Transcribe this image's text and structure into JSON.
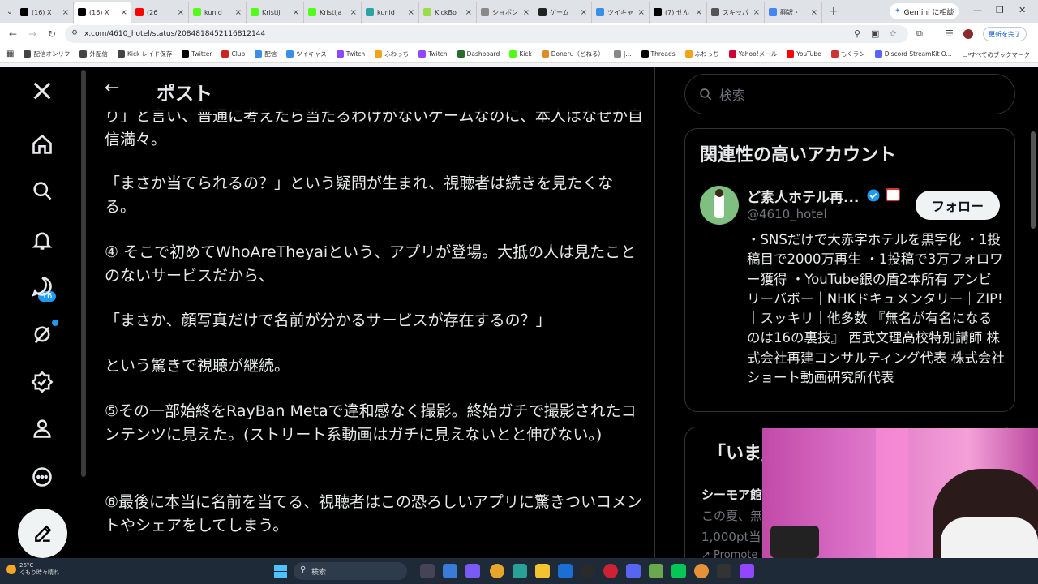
{
  "browser": {
    "tabs": [
      {
        "label": "(16) X",
        "icon": "x-icon",
        "color": "#000000"
      },
      {
        "label": "(16) X",
        "icon": "x-icon",
        "color": "#000000",
        "active": true
      },
      {
        "label": "(26",
        "icon": "youtube-icon",
        "color": "#ff0000"
      },
      {
        "label": "kunid",
        "icon": "kick-icon",
        "color": "#53fc18"
      },
      {
        "label": "Kristij",
        "icon": "kick-icon",
        "color": "#53fc18"
      },
      {
        "label": "Kristija",
        "icon": "kick-icon",
        "color": "#53fc18"
      },
      {
        "label": "kunid",
        "icon": "twitch-icon",
        "color": "#29a3a3"
      },
      {
        "label": "KickBo",
        "icon": "kickbot-icon",
        "color": "#9bdc4a"
      },
      {
        "label": "ショボン",
        "icon": "page-icon",
        "color": "#888888"
      },
      {
        "label": "ゲーム",
        "icon": "game-icon",
        "color": "#222222"
      },
      {
        "label": "ツイキャ",
        "icon": "twitcasting-icon",
        "color": "#3a8ee6"
      },
      {
        "label": "(7) せん",
        "icon": "x-icon",
        "color": "#000000"
      },
      {
        "label": "スキッパ",
        "icon": "page-icon",
        "color": "#555555"
      },
      {
        "label": "翻訳・",
        "icon": "google-icon",
        "color": "#4285f4"
      }
    ],
    "gemini_label": "Gemini に相談",
    "url": "x.com/4610_hotel/status/2084818452116812144",
    "update_label": "更新を完了",
    "bookmarks": [
      {
        "label": "配信オンリフ",
        "color": "#444444"
      },
      {
        "label": "外配信",
        "color": "#444444"
      },
      {
        "label": "Kick レイド保存",
        "color": "#444444"
      },
      {
        "label": "Twitter",
        "color": "#000000"
      },
      {
        "label": "Club",
        "color": "#cc2222"
      },
      {
        "label": "配信",
        "color": "#3a8ee6"
      },
      {
        "label": "ツイキャス",
        "color": "#3a8ee6"
      },
      {
        "label": "Twitch",
        "color": "#9146ff"
      },
      {
        "label": "ふわっち",
        "color": "#f2a31b"
      },
      {
        "label": "Twitch",
        "color": "#9146ff"
      },
      {
        "label": "Dashboard",
        "color": "#2a6a2a"
      },
      {
        "label": "Kick",
        "color": "#53fc18"
      },
      {
        "label": "Doneru（どねる）",
        "color": "#e08a2a"
      },
      {
        "label": "|...",
        "color": "#888888"
      },
      {
        "label": "Threads",
        "color": "#000000"
      },
      {
        "label": "ふわっち",
        "color": "#f2a31b"
      },
      {
        "label": "Yahoo!メール",
        "color": "#cc0033"
      },
      {
        "label": "YouTube",
        "color": "#ff0000"
      },
      {
        "label": "もくラン",
        "color": "#cc3333"
      },
      {
        "label": "Discord StreamKit O...",
        "color": "#5865f2"
      }
    ],
    "bookmarks_more": "»",
    "all_bookmarks": "すべてのブックマーク"
  },
  "nav": {
    "notification_count": "16"
  },
  "post": {
    "back_arrow": "←",
    "title": "ポスト",
    "paragraphs": [
      "り」と言い、普通に考えたら当たるわけがないゲームなのに、本人はなぜか自信満々。",
      "「まさか当てられるの？」という疑問が生まれ、視聴者は続きを見たくなる。",
      "④ そこで初めてWhoAreTheyaiという、アプリが登場。大抵の人は見たことのないサービスだから、",
      "「まさか、顔写真だけで名前が分かるサービスが存在するの？」",
      "という驚きで視聴が継続。",
      "⑤その一部始終をRayBan Metaで違和感なく撮影。終始ガチで撮影されたコンテンツに見えた。(ストリート系動画はガチに見えないとと伸びない。)",
      "⑥最後に本当に名前を当てる、視聴者はこの恐ろしいアプリに驚きついコメントやシェアをしてしまう。"
    ]
  },
  "sidebar": {
    "search_placeholder": "検索",
    "related_title": "関連性の高いアカウント",
    "account": {
      "name": "ど素人ホテル再...",
      "handle": "@4610_hotel",
      "follow_label": "フォロー",
      "bio": "・SNSだけで大赤字ホテルを黒字化 ・1投稿目で2000万再生 ・1投稿で3万フォロワー獲得 ・YouTube銀の盾2本所有 アンビリーバボー｜NHKドキュメンタリー｜ZIP!｜スッキリ｜他多数 『無名が有名になるのは16の裏技』 西武文理高校特別講師 株式会社再建コンサルティング代表 株式会社ショート動画研究所代表"
    },
    "trends_title": "「いま」",
    "trend_1": "シーモア館",
    "trend_2": "この夏、無",
    "trend_3": "1,000pt当",
    "promoted": "Promote"
  },
  "taskbar": {
    "temperature": "26°C",
    "weather": "くもり時々晴れ",
    "search_label": "検索"
  }
}
